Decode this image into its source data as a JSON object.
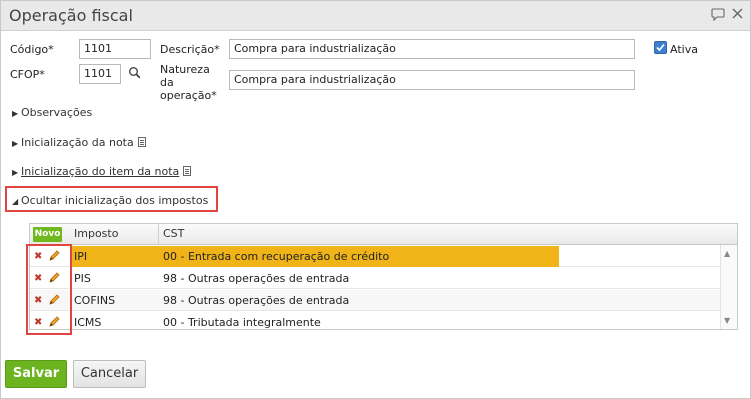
{
  "window": {
    "title": "Operação fiscal"
  },
  "form": {
    "codigo_label": "Código*",
    "codigo_value": "1101",
    "cfop_label": "CFOP*",
    "cfop_value": "1101",
    "descricao_label": "Descrição*",
    "descricao_value": "Compra para industrialização",
    "natureza_label_1": "Natureza",
    "natureza_label_2": "da",
    "natureza_label_3": "operação*",
    "natureza_value": "Compra para industrialização",
    "ativa_label": "Ativa",
    "ativa_checked": true
  },
  "sections": {
    "observacoes": "Observações",
    "inicializacao_nota": "Inicialização da nota",
    "inicializacao_item": "Inicialização do item da nota",
    "ocultar_impostos": "Ocultar inicialização dos impostos"
  },
  "grid": {
    "new_label": "Novo",
    "columns": [
      "Imposto",
      "CST"
    ],
    "rows": [
      {
        "imposto": "IPI",
        "cst": "00 - Entrada com recuperação de crédito",
        "selected": true
      },
      {
        "imposto": "PIS",
        "cst": "98 - Outras operações de entrada",
        "selected": false
      },
      {
        "imposto": "COFINS",
        "cst": "98 - Outras operações de entrada",
        "selected": false
      },
      {
        "imposto": "ICMS",
        "cst": "00 - Tributada integralmente",
        "selected": false
      }
    ]
  },
  "buttons": {
    "save": "Salvar",
    "cancel": "Cancelar"
  },
  "icons": {
    "comment": "comment-icon",
    "close": "close-icon",
    "search": "search-icon",
    "delete": "delete-icon",
    "edit": "pencil-icon"
  },
  "colors": {
    "highlight_row": "#f0b419",
    "save_button": "#6bb31f",
    "annotation_box": "#e0453f"
  }
}
